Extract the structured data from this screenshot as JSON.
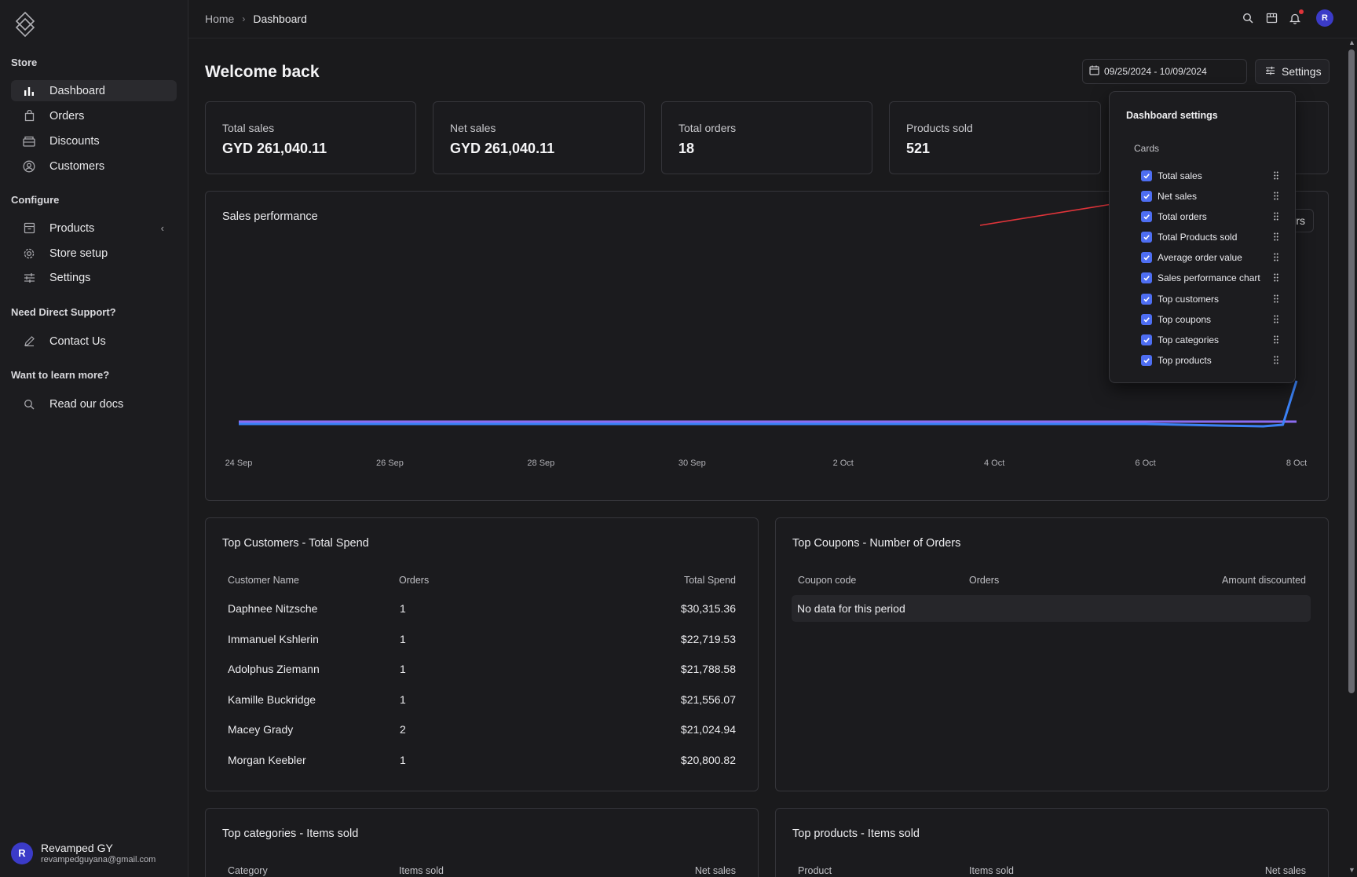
{
  "sidebar": {
    "store_label": "Store",
    "configure_label": "Configure",
    "support_label": "Need Direct Support?",
    "learn_label": "Want to learn more?",
    "items": {
      "dashboard": "Dashboard",
      "orders": "Orders",
      "discounts": "Discounts",
      "customers": "Customers",
      "products": "Products",
      "store_setup": "Store setup",
      "settings": "Settings",
      "contact": "Contact Us",
      "docs": "Read our docs"
    },
    "user": {
      "initial": "R",
      "name": "Revamped GY",
      "email": "revampedguyana@gmail.com"
    }
  },
  "header": {
    "breadcrumb_home": "Home",
    "breadcrumb_current": "Dashboard",
    "avatar_initial": "R",
    "icons": [
      "search-icon",
      "store-icon",
      "bell-icon"
    ]
  },
  "main": {
    "title": "Welcome back",
    "date_range": "09/25/2024 - 10/09/2024",
    "settings_label": "Settings",
    "stats": [
      {
        "label": "Total sales",
        "value": "GYD 261,040.11"
      },
      {
        "label": "Net sales",
        "value": "GYD 261,040.11"
      },
      {
        "label": "Total orders",
        "value": "18"
      },
      {
        "label": "Products sold",
        "value": "521"
      }
    ],
    "sales_title": "Sales performance",
    "sales_button_partial": "rs",
    "top_customers": {
      "title": "Top Customers - Total Spend",
      "headers": [
        "Customer Name",
        "Orders",
        "Total Spend"
      ],
      "rows": [
        [
          "Daphnee Nitzsche",
          "1",
          "$30,315.36"
        ],
        [
          "Immanuel Kshlerin",
          "1",
          "$22,719.53"
        ],
        [
          "Adolphus Ziemann",
          "1",
          "$21,788.58"
        ],
        [
          "Kamille Buckridge",
          "1",
          "$21,556.07"
        ],
        [
          "Macey Grady",
          "2",
          "$21,024.94"
        ],
        [
          "Morgan Keebler",
          "1",
          "$20,800.82"
        ]
      ]
    },
    "top_coupons": {
      "title": "Top Coupons - Number of Orders",
      "headers": [
        "Coupon code",
        "Orders",
        "Amount discounted"
      ],
      "empty": "No data for this period"
    },
    "top_categories": {
      "title": "Top categories - Items sold",
      "headers": [
        "Category",
        "Items sold",
        "Net sales"
      ]
    },
    "top_products": {
      "title": "Top products - Items sold",
      "headers": [
        "Product",
        "Items sold",
        "Net sales"
      ]
    }
  },
  "popover": {
    "title": "Dashboard settings",
    "subtitle": "Cards",
    "items": [
      "Total sales",
      "Net sales",
      "Total orders",
      "Total Products sold",
      "Average order value",
      "Sales performance chart",
      "Top customers",
      "Top coupons",
      "Top categories",
      "Top products"
    ]
  },
  "chart_data": {
    "type": "line",
    "x": [
      "24 Sep",
      "26 Sep",
      "28 Sep",
      "30 Sep",
      "2 Oct",
      "4 Oct",
      "6 Oct",
      "8 Oct"
    ],
    "x_tick_labels": [
      "24 Sep",
      "26 Sep",
      "28 Sep",
      "30 Sep",
      "2 Oct",
      "4 Oct",
      "6 Oct",
      "8 Oct"
    ],
    "series": [
      {
        "color": "#3b82f6",
        "values": [
          0,
          0,
          0,
          0,
          0,
          0,
          0,
          0.3
        ]
      },
      {
        "color": "#8b6cf0",
        "values": [
          0,
          0,
          0,
          0,
          0,
          0,
          0,
          0
        ]
      }
    ],
    "colors": {
      "accent": "#4e6ef2",
      "annotation_arrow": "#e0343a"
    }
  }
}
